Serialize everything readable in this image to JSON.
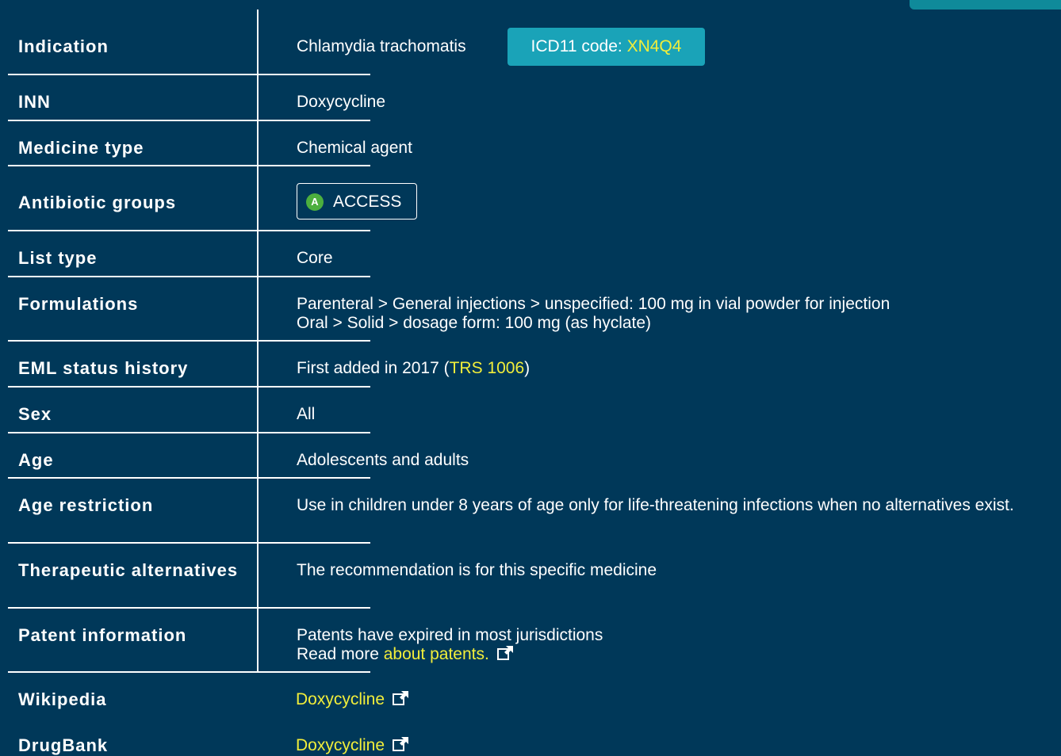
{
  "rows": {
    "indication": {
      "label": "Indication",
      "value": "Chlamydia trachomatis",
      "icd_prefix": "ICD11 code: ",
      "icd_code": "XN4Q4"
    },
    "inn": {
      "label": "INN",
      "value": "Doxycycline"
    },
    "medicine_type": {
      "label": "Medicine type",
      "value": "Chemical agent"
    },
    "antibiotic_groups": {
      "label": "Antibiotic groups",
      "badge_letter": "A",
      "badge_text": "ACCESS"
    },
    "list_type": {
      "label": "List type",
      "value": "Core"
    },
    "formulations": {
      "label": "Formulations",
      "lines": [
        "Parenteral > General injections > unspecified: 100 mg in vial powder for injection",
        "Oral > Solid > dosage form: 100 mg (as hyclate)"
      ]
    },
    "eml_status": {
      "label": "EML status history",
      "prefix": "First added in 2017 (",
      "link": "TRS 1006",
      "suffix": ")"
    },
    "sex": {
      "label": "Sex",
      "value": "All"
    },
    "age": {
      "label": "Age",
      "value": "Adolescents and adults"
    },
    "age_restriction": {
      "label": "Age restriction",
      "value": "Use in children under 8 years of age only for life-threatening infections when no alternatives exist."
    },
    "therapeutic_alternatives": {
      "label": "Therapeutic alternatives",
      "value": "The recommendation is for this specific medicine"
    },
    "patent": {
      "label": "Patent information",
      "line1": "Patents have expired in most jurisdictions",
      "line2_prefix": "Read more ",
      "line2_link": "about patents."
    },
    "wikipedia": {
      "label": "Wikipedia",
      "link": "Doxycycline"
    },
    "drugbank": {
      "label": "DrugBank",
      "link": "Doxycycline"
    }
  },
  "colors": {
    "background": "#003859",
    "link": "#f2ee3a",
    "icd_badge": "#1aa3b8",
    "access_green": "#4caf3e",
    "top_tab": "#0f8a9a"
  },
  "icons": {
    "external_link": "external-link-icon"
  }
}
